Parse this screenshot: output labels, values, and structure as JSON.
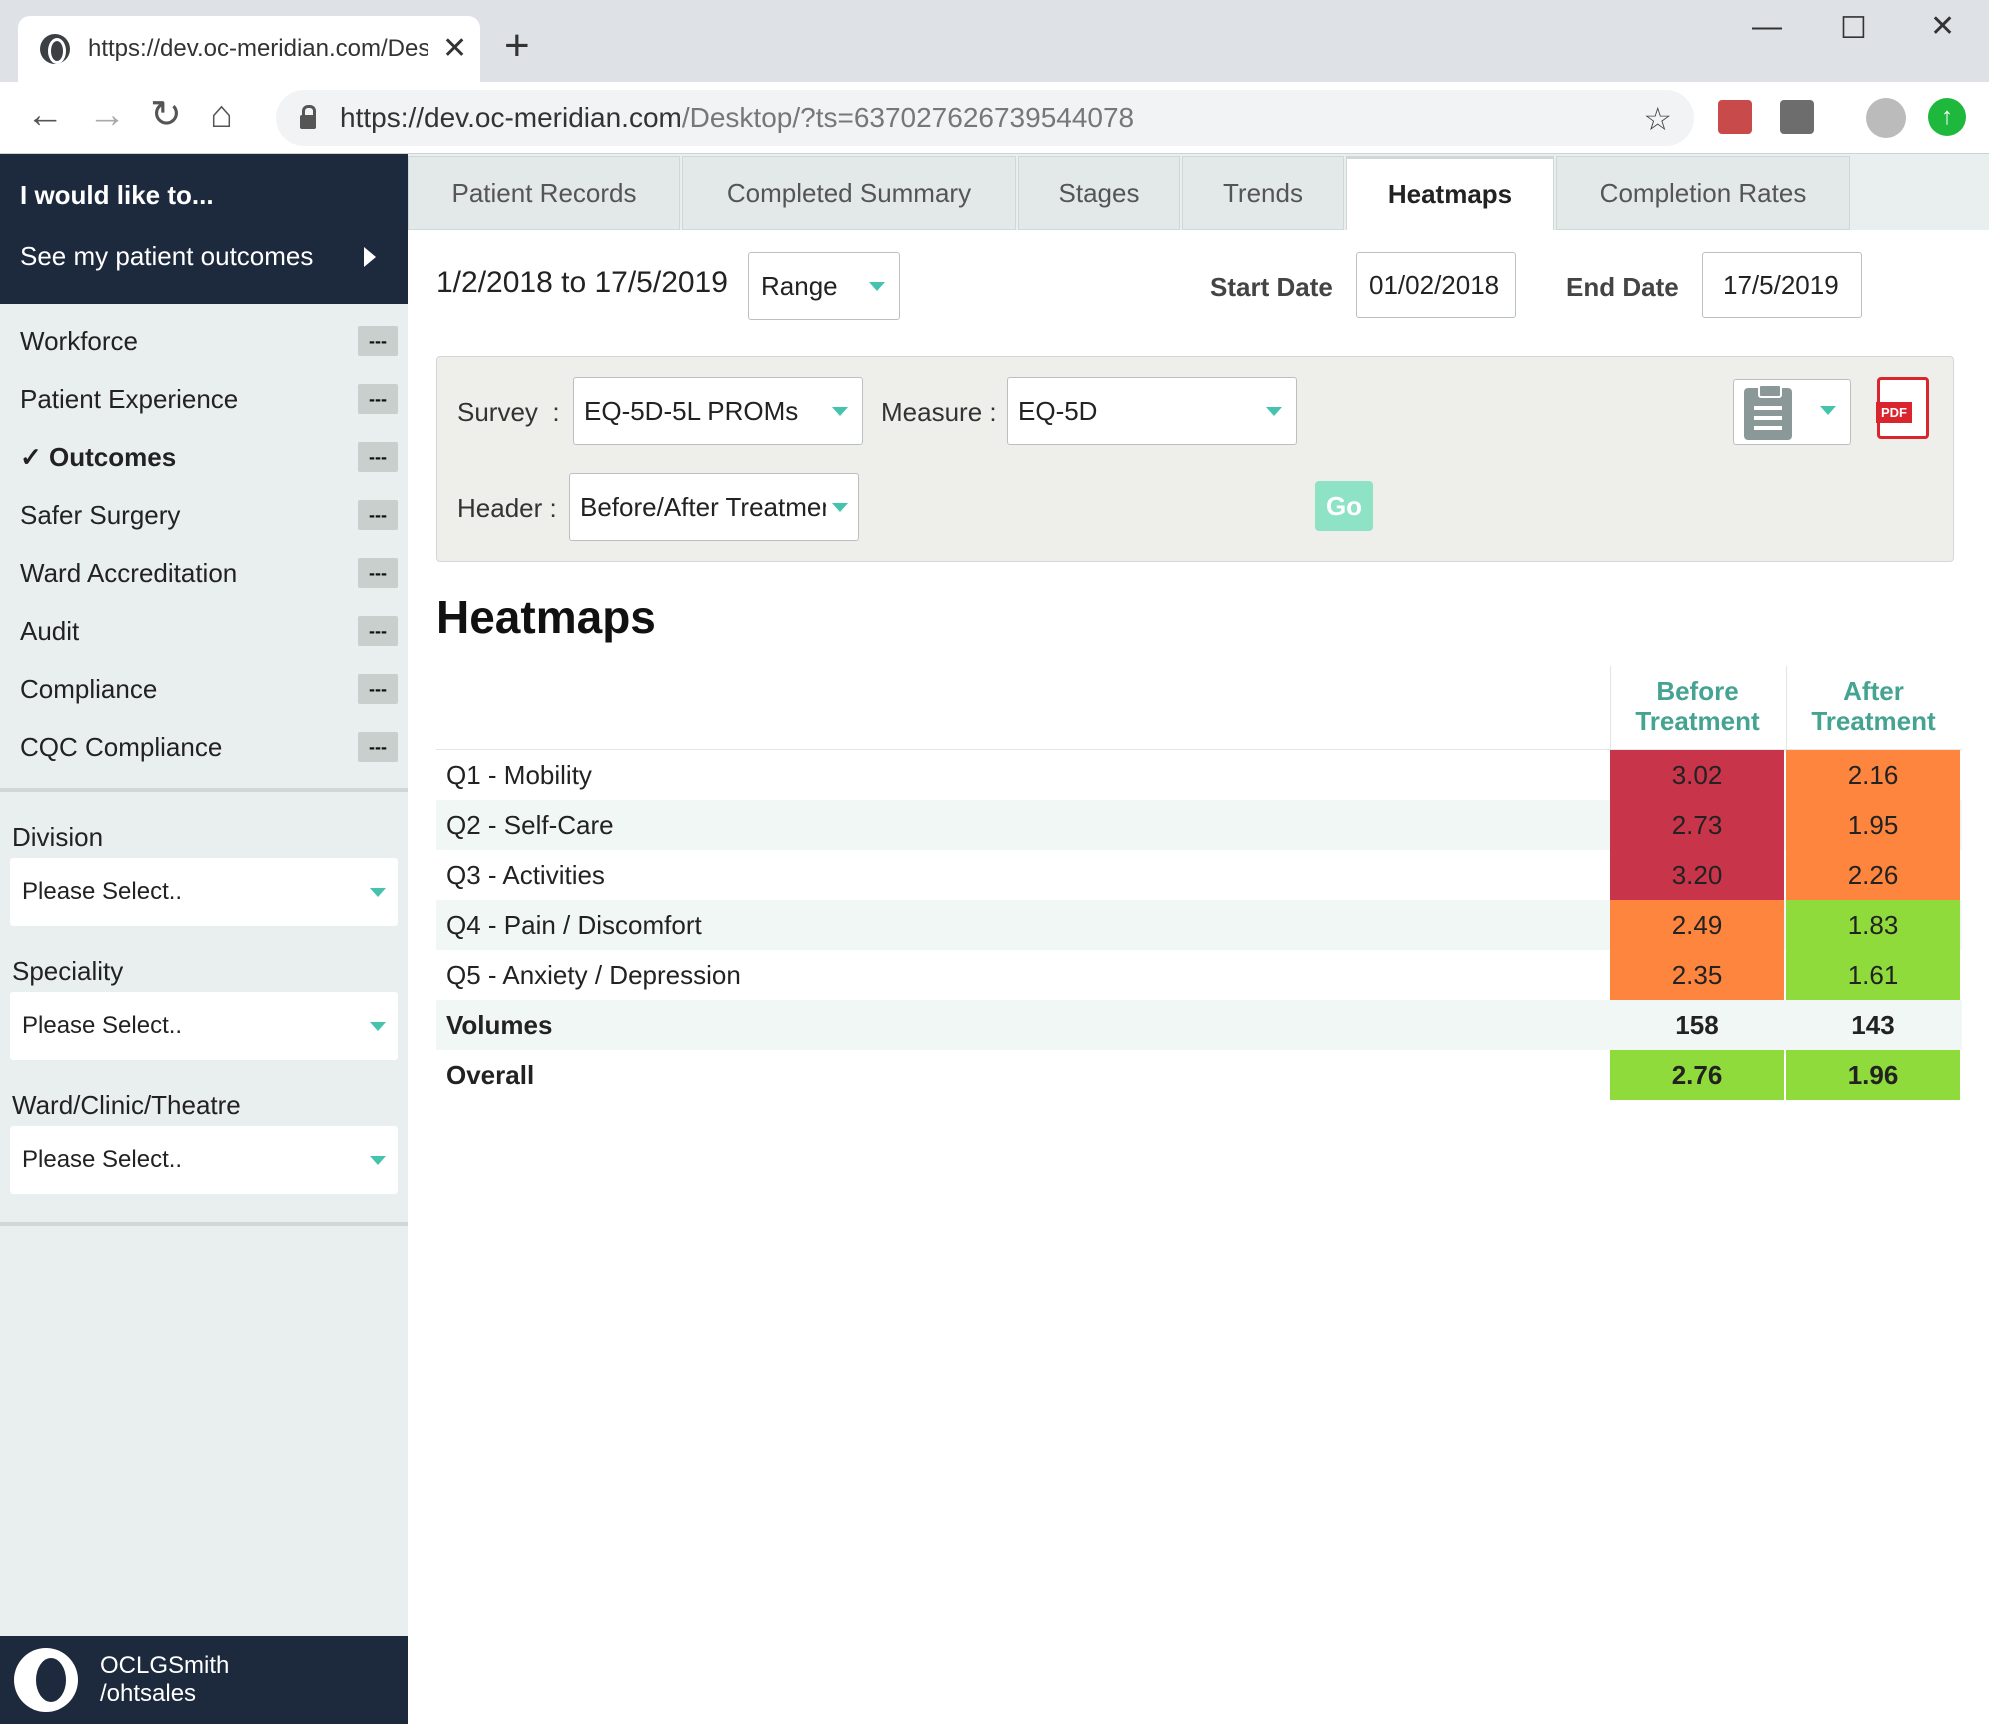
{
  "browser": {
    "tab_title": "https://dev.oc-meridian.com/Des",
    "url_host": "https://dev.oc-meridian.com",
    "url_path": "/Desktop/?ts=637027626739544078"
  },
  "sidebar": {
    "heading": "I would like to...",
    "outcomes_link": "See my patient outcomes",
    "menu": [
      {
        "label": "Workforce",
        "badge": "---"
      },
      {
        "label": "Patient Experience",
        "badge": "---"
      },
      {
        "label": "✓ Outcomes",
        "badge": "---"
      },
      {
        "label": "Safer Surgery",
        "badge": "---"
      },
      {
        "label": "Ward Accreditation",
        "badge": "---"
      },
      {
        "label": "Audit",
        "badge": "---"
      },
      {
        "label": "Compliance",
        "badge": "---"
      },
      {
        "label": "CQC Compliance",
        "badge": "---"
      }
    ],
    "filters": [
      {
        "label": "Division",
        "value": "Please Select.."
      },
      {
        "label": "Speciality",
        "value": "Please Select.."
      },
      {
        "label": "Ward/Clinic/Theatre",
        "value": "Please Select.."
      }
    ],
    "user_line1": "OCLGSmith",
    "user_line2": "/ohtsales"
  },
  "tabs": [
    "Patient Records",
    "Completed Summary",
    "Stages",
    "Trends",
    "Heatmaps",
    "Completion Rates"
  ],
  "active_tab": "Heatmaps",
  "date_range": {
    "text": "1/2/2018 to 17/5/2019",
    "mode": "Range",
    "start_label": "Start Date",
    "start_value": "01/02/2018",
    "end_label": "End Date",
    "end_value": "17/5/2019"
  },
  "filters": {
    "survey_label": "Survey",
    "survey_value": "EQ-5D-5L PROMs",
    "measure_label": "Measure :",
    "measure_value": "EQ-5D",
    "header_label": "Header :",
    "header_value": "Before/After Treatment",
    "go_label": "Go"
  },
  "page_title": "Heatmaps",
  "colors": {
    "red": "#c8344a",
    "orange": "#fe853d",
    "green": "#8fdb3c",
    "accent": "#45c3ad"
  },
  "heatmap": {
    "columns": [
      "Before Treatment",
      "After Treatment"
    ],
    "rows": [
      {
        "label": "Q1 - Mobility",
        "values": [
          "3.02",
          "2.16"
        ],
        "colors": [
          "red",
          "orange"
        ]
      },
      {
        "label": "Q2 - Self-Care",
        "values": [
          "2.73",
          "1.95"
        ],
        "colors": [
          "red",
          "orange"
        ]
      },
      {
        "label": "Q3 - Activities",
        "values": [
          "3.20",
          "2.26"
        ],
        "colors": [
          "red",
          "orange"
        ]
      },
      {
        "label": "Q4 - Pain / Discomfort",
        "values": [
          "2.49",
          "1.83"
        ],
        "colors": [
          "orange",
          "green"
        ]
      },
      {
        "label": "Q5 - Anxiety / Depression",
        "values": [
          "2.35",
          "1.61"
        ],
        "colors": [
          "orange",
          "green"
        ]
      }
    ],
    "volumes": {
      "label": "Volumes",
      "values": [
        "158",
        "143"
      ]
    },
    "overall": {
      "label": "Overall",
      "values": [
        "2.76",
        "1.96"
      ],
      "colors": [
        "green",
        "green"
      ]
    }
  }
}
